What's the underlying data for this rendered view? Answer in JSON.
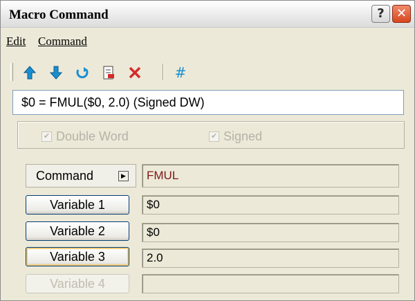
{
  "window": {
    "title": "Macro Command"
  },
  "title_buttons": {
    "help": "?",
    "close": "✕"
  },
  "menu": {
    "items": [
      "Edit",
      "Command"
    ]
  },
  "toolbar": {
    "icons": [
      "arrow-up-icon",
      "arrow-down-icon",
      "undo-icon",
      "document-edit-icon",
      "delete-icon",
      "hash-icon"
    ]
  },
  "preview": {
    "text": "$0 = FMUL($0, 2.0) (Signed DW)"
  },
  "options": {
    "double_word": {
      "label": "Double Word",
      "checked": true,
      "enabled": false
    },
    "signed": {
      "label": "Signed",
      "checked": true,
      "enabled": false
    }
  },
  "command": {
    "label": "Command",
    "value": "FMUL"
  },
  "variables": [
    {
      "label": "Variable 1",
      "value": "$0",
      "enabled": true
    },
    {
      "label": "Variable 2",
      "value": "$0",
      "enabled": true
    },
    {
      "label": "Variable 3",
      "value": "2.0",
      "enabled": true
    },
    {
      "label": "Variable 4",
      "value": "",
      "enabled": false
    }
  ],
  "colors": {
    "accent": "#1a8fd0",
    "delete": "#d42a2a",
    "command_text": "#7a1818"
  }
}
